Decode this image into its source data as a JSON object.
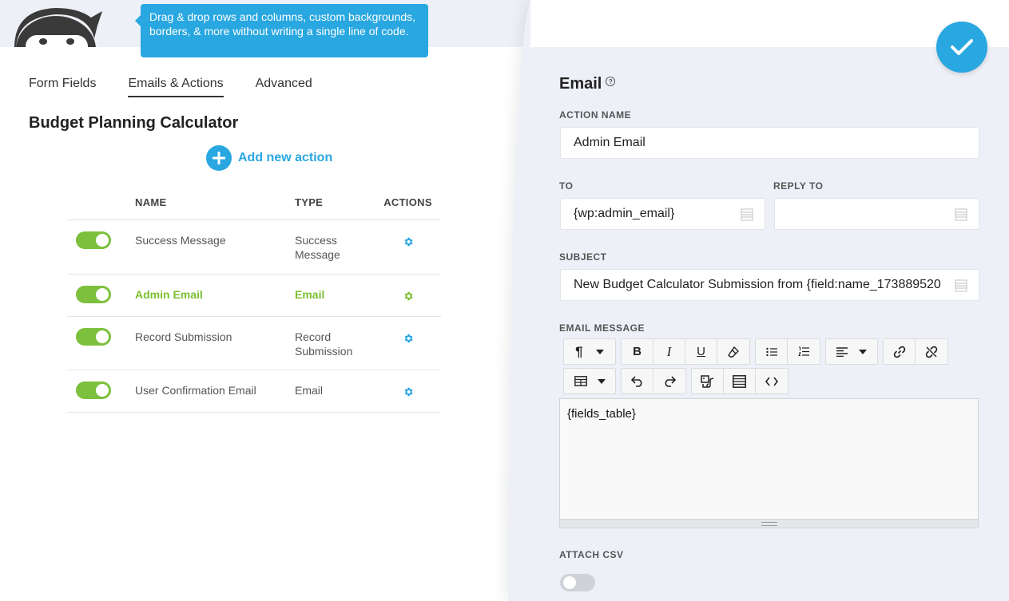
{
  "tooltip": {
    "text": "Drag & drop rows and columns, custom backgrounds, borders, & more without writing a single line of code."
  },
  "tabs": [
    {
      "label": "Form Fields"
    },
    {
      "label": "Emails & Actions"
    },
    {
      "label": "Advanced"
    }
  ],
  "form": {
    "title": "Budget Planning Calculator"
  },
  "add_action": {
    "label": "Add new action"
  },
  "table": {
    "headers": {
      "name": "NAME",
      "type": "TYPE",
      "actions": "ACTIONS"
    },
    "rows": [
      {
        "name": "Success Message",
        "type": "Success Message",
        "enabled": true
      },
      {
        "name": "Admin Email",
        "type": "Email",
        "enabled": true
      },
      {
        "name": "Record Submission",
        "type": "Record Submission",
        "enabled": true
      },
      {
        "name": "User Confirmation Email",
        "type": "Email",
        "enabled": true
      }
    ]
  },
  "panel": {
    "title": "Email",
    "help_icon": "?",
    "action_name": {
      "label": "ACTION NAME",
      "value": "Admin Email"
    },
    "to": {
      "label": "TO",
      "value": "{wp:admin_email}"
    },
    "reply_to": {
      "label": "REPLY TO",
      "value": ""
    },
    "subject": {
      "label": "SUBJECT",
      "value": "New Budget Calculator Submission from {field:name_173889520"
    },
    "email_message": {
      "label": "EMAIL MESSAGE",
      "value": "{fields_table}"
    },
    "attach_csv": {
      "label": "ATTACH CSV",
      "enabled": false
    }
  },
  "colors": {
    "accent": "#29a7e1",
    "toggle_on": "#7dc03d",
    "highlight_text": "#7cc032",
    "panel_bg": "#eef0f7"
  },
  "icons": [
    "ninja-logo",
    "plus-icon",
    "gear-icon",
    "check-icon",
    "help-icon",
    "merge-tags-icon",
    "paragraph-icon",
    "bold-icon",
    "italic-icon",
    "underline-icon",
    "eraser-icon",
    "bullet-list-icon",
    "numbered-list-icon",
    "align-icon",
    "link-icon",
    "unlink-icon",
    "table-icon",
    "undo-icon",
    "redo-icon",
    "media-icon",
    "merge-fields-icon",
    "code-icon"
  ]
}
